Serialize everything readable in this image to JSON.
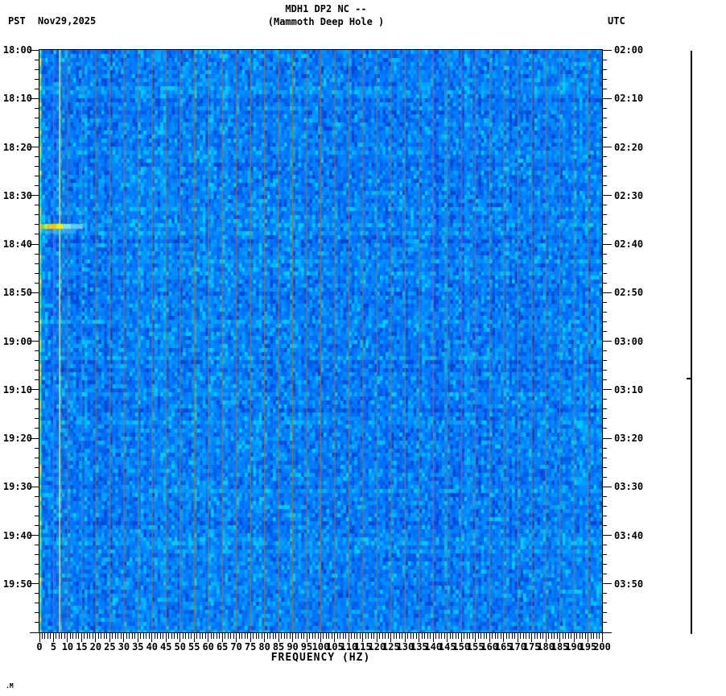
{
  "header": {
    "title": "MDH1 DP2 NC --",
    "subtitle": "(Mammoth Deep Hole )",
    "left_timezone": "PST",
    "date": "Nov29,2025",
    "right_timezone": "UTC"
  },
  "watermark": ".M",
  "chart_data": {
    "type": "heatmap",
    "subtype": "seismic-spectrogram",
    "title": "MDH1 DP2 NC --",
    "subtitle": "(Mammoth Deep Hole )",
    "xlabel": "FREQUENCY (HZ)",
    "x_axis": {
      "min_hz": 0,
      "max_hz": 200,
      "major_tick_step_hz": 5,
      "minor_tick_step_hz": 1,
      "tick_labels": [
        "0",
        "5",
        "10",
        "15",
        "20",
        "25",
        "30",
        "35",
        "40",
        "45",
        "50",
        "55",
        "60",
        "65",
        "70",
        "75",
        "80",
        "85",
        "90",
        "95",
        "100",
        "105",
        "110",
        "115",
        "120",
        "125",
        "130",
        "135",
        "140",
        "145",
        "150",
        "155",
        "160",
        "165",
        "170",
        "175",
        "180",
        "185",
        "190",
        "195",
        "200"
      ]
    },
    "y_axis_left": {
      "timezone": "PST",
      "date": "Nov29,2025",
      "start_time": "18:00",
      "end_time": "20:00",
      "span_minutes": 120,
      "major_tick_step_min": 10,
      "minor_tick_step_min": 2,
      "tick_labels": [
        "18:00",
        "18:10",
        "18:20",
        "18:30",
        "18:40",
        "18:50",
        "19:00",
        "19:10",
        "19:20",
        "19:30",
        "19:40",
        "19:50"
      ]
    },
    "y_axis_right": {
      "timezone": "UTC",
      "start_time": "02:00",
      "end_time": "04:00",
      "major_tick_step_min": 10,
      "minor_tick_step_min": 2,
      "tick_labels": [
        "02:00",
        "02:10",
        "02:20",
        "02:30",
        "02:40",
        "02:50",
        "03:00",
        "03:10",
        "03:20",
        "03:30",
        "03:40",
        "03:50"
      ]
    },
    "background_noise_palette": [
      "#0046d8",
      "#005ce8",
      "#006ef5",
      "#007dff",
      "#008dff",
      "#00a0ff",
      "#00b6ff",
      "#00ccff"
    ],
    "palette_weights": [
      0.05,
      0.13,
      0.22,
      0.24,
      0.16,
      0.11,
      0.06,
      0.03
    ],
    "gridlines": {
      "step_hz": 5,
      "color": "rgba(170,118,58,0.85)"
    },
    "features": {
      "low_freq_edge_column": {
        "hz_range": [
          0,
          0.6
        ],
        "colors": [
          "#3fe08f",
          "#62e8a0",
          "#2fd4c8",
          "#9ff060",
          "#50dcc0",
          "#ffe94a"
        ]
      },
      "narrowband_line": {
        "hz": 7,
        "colors": [
          "#ffd94a",
          "#ffc832",
          "#e8e85a",
          "#c8ee6a",
          "#ffe14a"
        ]
      },
      "event": {
        "time_pst": "18:36",
        "time_utc": "02:36",
        "row_minutes": [
          35.85,
          36.85
        ],
        "freq_extent_hz": [
          0,
          15.5
        ],
        "segments": [
          {
            "hz": [
              0,
              0.5
            ],
            "color": "#ffb030"
          },
          {
            "hz": [
              0.5,
              1.7
            ],
            "color": "#66e05a"
          },
          {
            "hz": [
              1.7,
              3.0
            ],
            "color": "#c8f030"
          },
          {
            "hz": [
              3.0,
              6.0
            ],
            "color": "#ffc81e"
          },
          {
            "hz": [
              6.0,
              8.3
            ],
            "color": "#ffec00"
          },
          {
            "hz": [
              8.3,
              11.2
            ],
            "color": "#7ee6e0"
          },
          {
            "hz": [
              11.2,
              15.5
            ],
            "color": "#62c8f5"
          }
        ],
        "afterglow": {
          "minutes": [
            36.85,
            37.8
          ],
          "hz": [
            0,
            13
          ],
          "color": "rgba(100,200,250,0.45)"
        }
      },
      "trace_line": {
        "present": true,
        "notch_fraction": 0.561
      }
    }
  }
}
